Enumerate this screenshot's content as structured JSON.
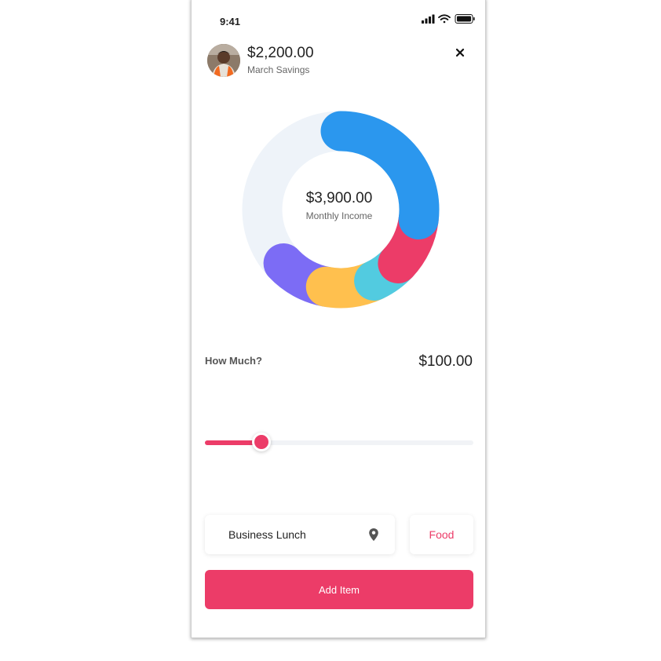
{
  "status_bar": {
    "time": "9:41"
  },
  "header": {
    "amount": "$2,200.00",
    "label": "March Savings",
    "icons": {
      "close": "close-icon"
    }
  },
  "donut": {
    "center_amount": "$3,900.00",
    "center_label": "Monthly Income",
    "track_color": "#eef3f9",
    "segments": [
      {
        "color": "#2b97ee",
        "from_percent": 0,
        "to_percent": 27
      },
      {
        "color": "#ec3c68",
        "from_percent": 27,
        "to_percent": 37
      },
      {
        "color": "#52cbe0",
        "from_percent": 37,
        "to_percent": 43
      },
      {
        "color": "#ffc04e",
        "from_percent": 43,
        "to_percent": 53
      },
      {
        "color": "#7c6cf5",
        "from_percent": 53,
        "to_percent": 63
      }
    ]
  },
  "form": {
    "how_much_label": "How Much?",
    "amount": "$100.00",
    "slider_percent": 21,
    "description": "Business Lunch",
    "category": "Food",
    "add_button": "Add Item",
    "icons": {
      "location": "location-pin-icon"
    }
  },
  "colors": {
    "accent": "#ec3c68"
  }
}
